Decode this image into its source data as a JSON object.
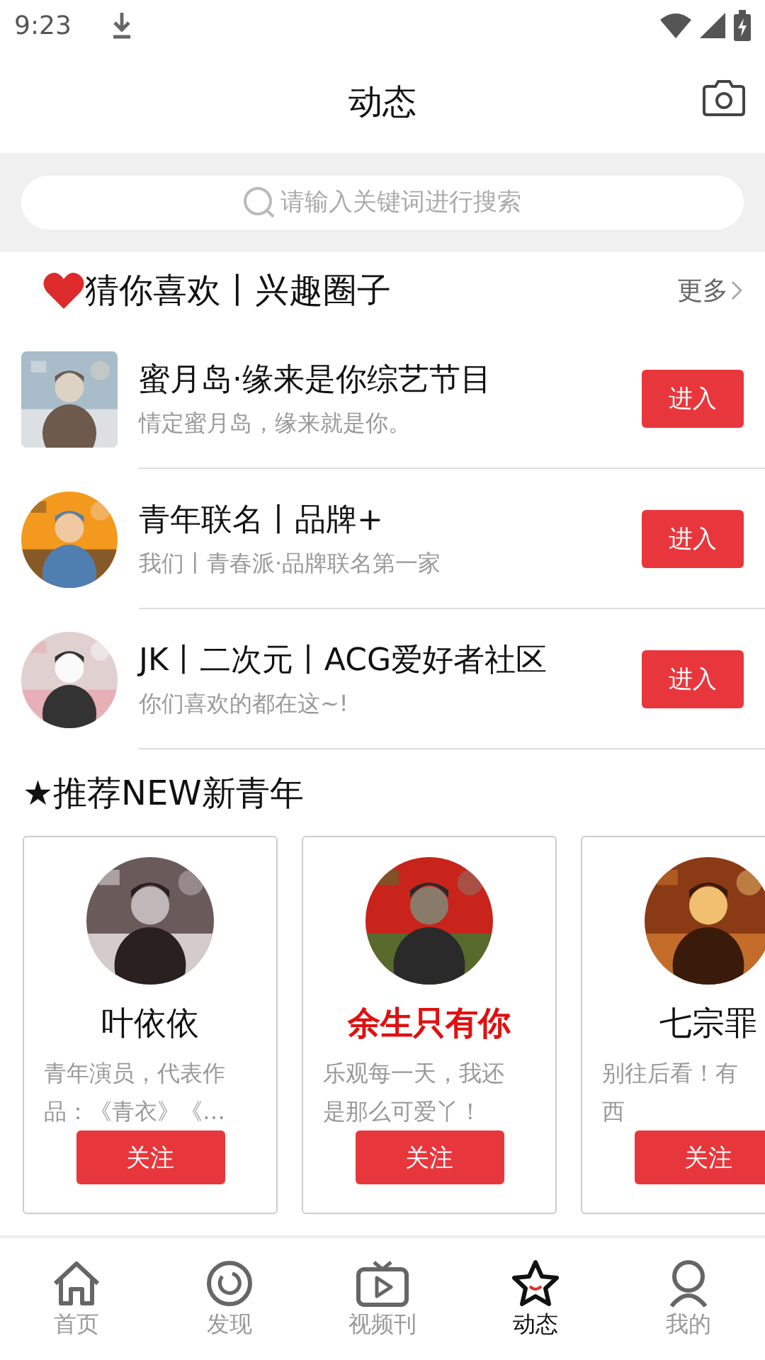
{
  "status_bar": {
    "time": "9:23"
  },
  "header": {
    "title": "动态"
  },
  "search": {
    "placeholder": "请输入关键词进行搜索"
  },
  "interest_section": {
    "title": "猜你喜欢丨兴趣圈子",
    "more": "更多",
    "groups": [
      {
        "name": "蜜月岛·缘来是你综艺节目",
        "subtitle": "情定蜜月岛，缘来就是你。",
        "kind": "square",
        "button": "进入"
      },
      {
        "name": "青年联名丨品牌+",
        "subtitle": "我们丨青春派·品牌联名第一家",
        "kind": "round",
        "button": "进入"
      },
      {
        "name": " JK丨二次元丨ACG爱好者社区",
        "subtitle": "你们喜欢的都在这~!",
        "kind": "round",
        "button": "进入"
      }
    ]
  },
  "recommend_section": {
    "title": "★推荐NEW新青年",
    "cards": [
      {
        "name": "叶依依",
        "highlighted": false,
        "bio_lines": [
          "青年演员，代表作",
          "品：《青衣》《…"
        ],
        "button": "关注"
      },
      {
        "name": "余生只有你",
        "highlighted": true,
        "bio_lines": [
          "乐观每一天，我还",
          "是那么可爱丫！"
        ],
        "button": "关注"
      },
      {
        "name": "七宗罪",
        "highlighted": false,
        "bio_lines": [
          "别往后看！有",
          "西"
        ],
        "button": "关注"
      }
    ]
  },
  "bottom_nav": [
    {
      "label": "首页",
      "kind": "home",
      "selected": false
    },
    {
      "label": "发现",
      "kind": "discover",
      "selected": false
    },
    {
      "label": "视频刊",
      "kind": "video",
      "selected": false
    },
    {
      "label": "动态",
      "kind": "star",
      "selected": true
    },
    {
      "label": "我的",
      "kind": "profile",
      "selected": false
    }
  ]
}
